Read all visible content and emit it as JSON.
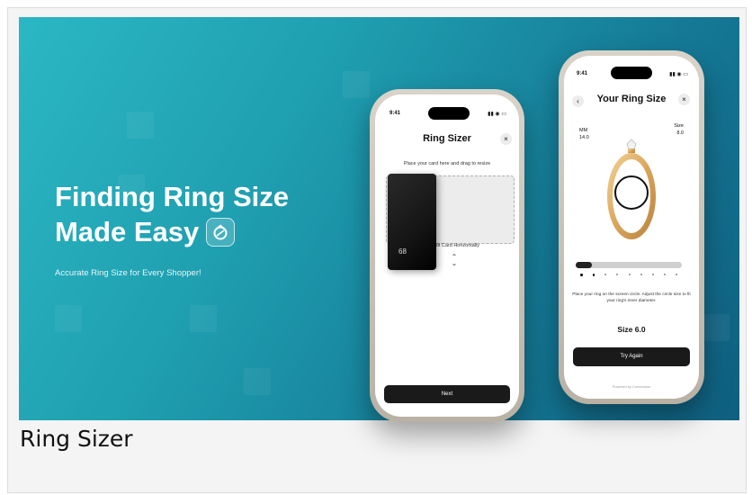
{
  "banner": {
    "headline_line1": "Finding Ring Size",
    "headline_line2": "Made Easy",
    "subheadline": "Accurate Ring Size for Every Shopper!"
  },
  "phone_left": {
    "status_time": "9:41",
    "title": "Ring Sizer",
    "close_label": "×",
    "hint": "Place your card here and drag to resize",
    "card_caption": "Align Credit Card Horizontally",
    "card_number": "68",
    "next_label": "Next"
  },
  "phone_right": {
    "status_time": "9:41",
    "back_label": "‹",
    "title": "Your Ring Size",
    "close_label": "×",
    "mm_label": "MM",
    "mm_value": "14.0",
    "size_label": "Size",
    "size_value": "8.0",
    "slider_fraction": 0.15,
    "instructions": "Place your ring on the screen circle. Adjust the circle size to fit your ring's inner diameter.",
    "result": "Size 6.0",
    "retry_label": "Try Again",
    "powered_by": "Powered by Conversion"
  },
  "caption": "Ring Sizer",
  "colors": {
    "banner_start": "#2bb7c4",
    "banner_end": "#0f5f80",
    "ring_gold": "#e0b46a",
    "button": "#1a1a1a"
  },
  "icons": [
    "ring-badge-icon",
    "close-icon",
    "back-icon",
    "resize-handle-icon",
    "ring-illustration"
  ]
}
